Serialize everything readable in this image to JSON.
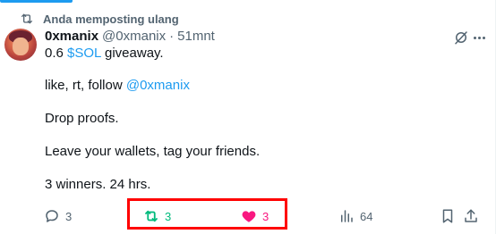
{
  "repost_banner": {
    "label": "Anda memposting ulang",
    "icon": "repost-icon"
  },
  "author": {
    "display_name": "0xmanix",
    "handle": "@0xmanix",
    "separator": "·",
    "time": "51mnt"
  },
  "tweet": {
    "line1_prefix": "0.6 ",
    "line1_cashtag": "$SOL",
    "line1_suffix": " giveaway.",
    "line2_prefix": "like, rt, follow ",
    "line2_mention": "@0xmanix",
    "line3": "Drop proofs.",
    "line4": "Leave your wallets, tag your friends.",
    "line5": "3 winners. 24 hrs."
  },
  "actions": {
    "reply_count": "3",
    "repost_count": "3",
    "like_count": "3",
    "views_count": "64"
  },
  "colors": {
    "accent": "#1d9bf0",
    "repost_active": "#00ba7c",
    "like_active": "#f91880",
    "muted": "#536471",
    "highlight": "#ff0000"
  },
  "icons": [
    "repost-icon",
    "grok-icon",
    "more-icon",
    "reply-icon",
    "views-icon",
    "bookmark-icon",
    "share-icon",
    "heart-icon"
  ]
}
